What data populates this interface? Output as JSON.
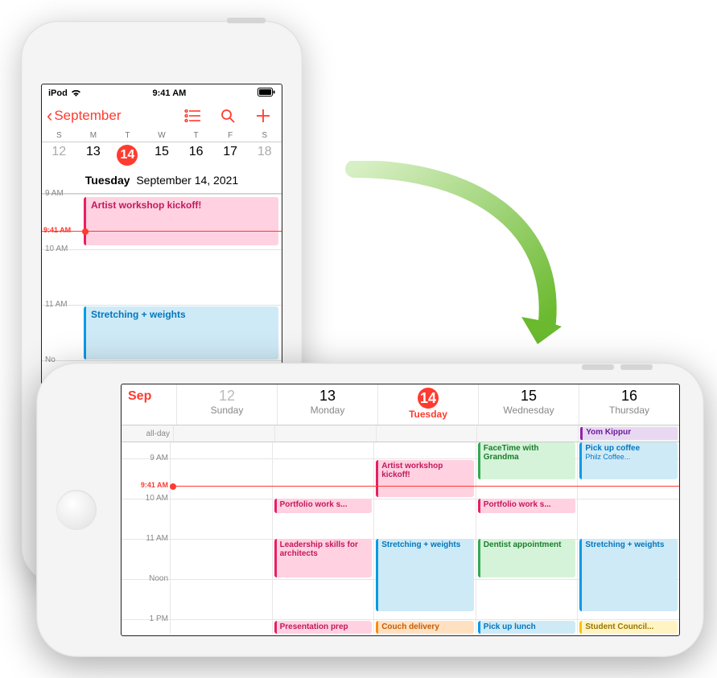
{
  "status": {
    "carrier": "iPod",
    "time": "9:41 AM"
  },
  "portrait": {
    "back_label": "September",
    "weekdays": [
      "S",
      "M",
      "T",
      "W",
      "T",
      "F",
      "S"
    ],
    "dates": [
      "12",
      "13",
      "14",
      "15",
      "16",
      "17",
      "18"
    ],
    "today_index": 2,
    "full_date_day": "Tuesday",
    "full_date_rest": "September 14, 2021",
    "hours": [
      "9 AM",
      "10 AM",
      "11 AM",
      "Noon"
    ],
    "now_label": "9:41 AM",
    "events": {
      "artist": "Artist workshop kickoff!",
      "stretch": "Stretching + weights"
    }
  },
  "landscape": {
    "month_short": "Sep",
    "days": [
      {
        "num": "12",
        "lbl": "Sunday"
      },
      {
        "num": "13",
        "lbl": "Monday"
      },
      {
        "num": "14",
        "lbl": "Tuesday"
      },
      {
        "num": "15",
        "lbl": "Wednesday"
      },
      {
        "num": "16",
        "lbl": "Thursday"
      }
    ],
    "allday_label": "all-day",
    "allday_event": "Yom Kippur",
    "hours": [
      "9 AM",
      "10 AM",
      "11 AM",
      "Noon",
      "1 PM"
    ],
    "now_label": "9:41 AM",
    "events": {
      "facetime": "FaceTime with Grandma",
      "pickup_coffee": "Pick up coffee",
      "philz": "Philz Coffee...",
      "artist": "Artist workshop kickoff!",
      "portfolio": "Portfolio work s...",
      "leadership": "Leadership skills for architects",
      "stretch": "Stretching + weights",
      "dentist": "Dentist appointment",
      "presentation": "Presentation prep",
      "couch": "Couch delivery",
      "lunch": "Pick up lunch",
      "council": "Student Council..."
    }
  }
}
